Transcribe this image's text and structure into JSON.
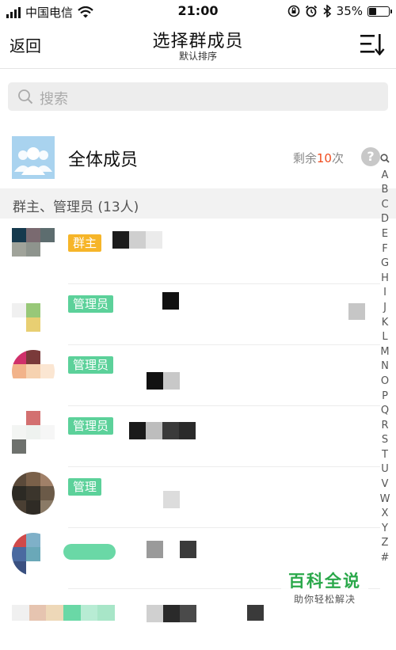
{
  "status_bar": {
    "carrier": "中国电信",
    "time": "21:00",
    "battery_percent": "35%",
    "battery_level": 0.35,
    "icons": [
      "signal-icon",
      "wifi-icon",
      "orientation-lock-icon",
      "alarm-icon",
      "bluetooth-icon",
      "battery-icon"
    ]
  },
  "nav": {
    "back_label": "返回",
    "title": "选择群成员",
    "subtitle": "默认排序",
    "sort_icon": "sort-icon"
  },
  "search": {
    "placeholder": "搜索"
  },
  "all_members": {
    "label": "全体成员",
    "remaining_prefix": "剩余",
    "remaining_count": "10",
    "remaining_suffix": "次",
    "help_label": "?"
  },
  "section": {
    "header": "群主、管理员 (13人)"
  },
  "members": [
    {
      "role": "群主",
      "role_type": "owner"
    },
    {
      "role": "管理员",
      "role_type": "admin"
    },
    {
      "role": "管理员",
      "role_type": "admin"
    },
    {
      "role": "管理员",
      "role_type": "admin"
    },
    {
      "role": "管理",
      "role_type": "admin"
    },
    {
      "role": "",
      "role_type": "none"
    },
    {
      "role": "",
      "role_type": "none"
    }
  ],
  "index_letters": [
    "Q",
    "A",
    "B",
    "C",
    "D",
    "E",
    "F",
    "G",
    "H",
    "I",
    "J",
    "K",
    "L",
    "M",
    "N",
    "O",
    "P",
    "Q",
    "R",
    "S",
    "T",
    "U",
    "V",
    "W",
    "X",
    "Y",
    "Z",
    "#"
  ],
  "watermark": {
    "title": "百科全说",
    "subtitle": "助你轻松解决"
  },
  "colors": {
    "owner_badge": "#f6b529",
    "admin_badge": "#5cd19a",
    "remaining_count": "#f04c1e",
    "search_bg": "#ededed",
    "section_bg": "#f2f2f2",
    "group_avatar_bg": "#a9d3ef"
  }
}
